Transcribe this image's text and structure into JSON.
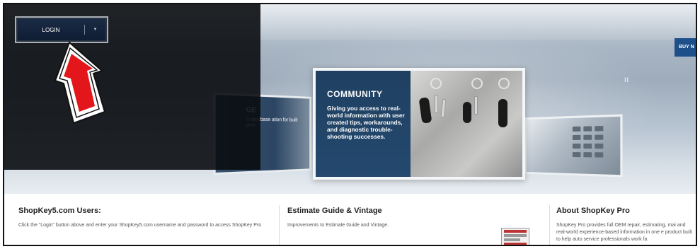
{
  "header": {
    "login_label": "LOGIN",
    "login_caret": "▼",
    "buy_label": "BUY N",
    "pause_glyph": "II"
  },
  "carousel": {
    "main": {
      "title": "COMMUNITY",
      "body": "Giving you access to real-world information with user created tips, workarounds, and diagnostic trouble-shooting successes."
    },
    "left": {
      "title": "GE",
      "body": "'s database ation for built prior"
    }
  },
  "sections": [
    {
      "title": "ShopKey5.com Users:",
      "body": "Click the \"Login\" button above and enter your ShopKey5.com username and password to access ShopKey Pro"
    },
    {
      "title": "Estimate Guide & Vintage",
      "body": "Improvements to Estimate Guide and Vintage."
    },
    {
      "title": "About ShopKey Pro",
      "body": "ShopKey Pro provides full OEM repair, estimating, mai and real-world experience-based information in one e product built to help auto service professionals work fa"
    }
  ],
  "colors": {
    "arrow_red": "#e3161b",
    "login_bg": "#12223b",
    "community_blue": "#1f4061",
    "buy_blue": "#1d4f8a"
  },
  "icons": {
    "arrow": "arrow-up-callout-icon",
    "caret": "chevron-down-icon",
    "pause": "pause-icon"
  }
}
